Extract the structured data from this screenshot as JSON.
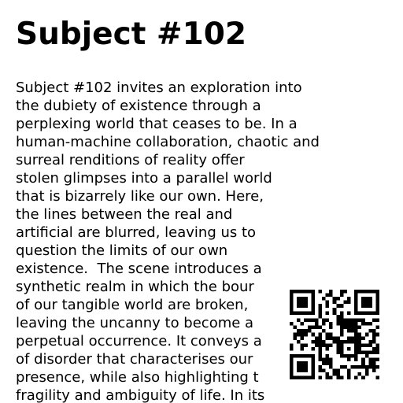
{
  "document": {
    "title": "Subject #102",
    "body_lines": [
      "Subject #102 invites an exploration into",
      "the dubiety of existence through a",
      "perplexing world that ceases to be. In a",
      "human-machine collaboration, chaotic and",
      "surreal renditions of reality offer",
      "stolen glimpses into a parallel world",
      "that is bizarrely like our own. Here,",
      "the lines between the real and",
      "artificial are blurred, leaving us to",
      "question the limits of our own",
      "existence.  The scene introduces a",
      "synthetic realm in which the bour",
      "of our tangible world are broken,",
      "leaving the uncanny to become a",
      "perpetual occurrence. It conveys a",
      "of disorder that characterises our",
      "presence, while also highlighting t",
      "fragility and ambiguity of life. In its"
    ]
  },
  "qr_code": {
    "icon": "qr-code-icon",
    "foreground": "#000000",
    "background": "#ffffff"
  }
}
